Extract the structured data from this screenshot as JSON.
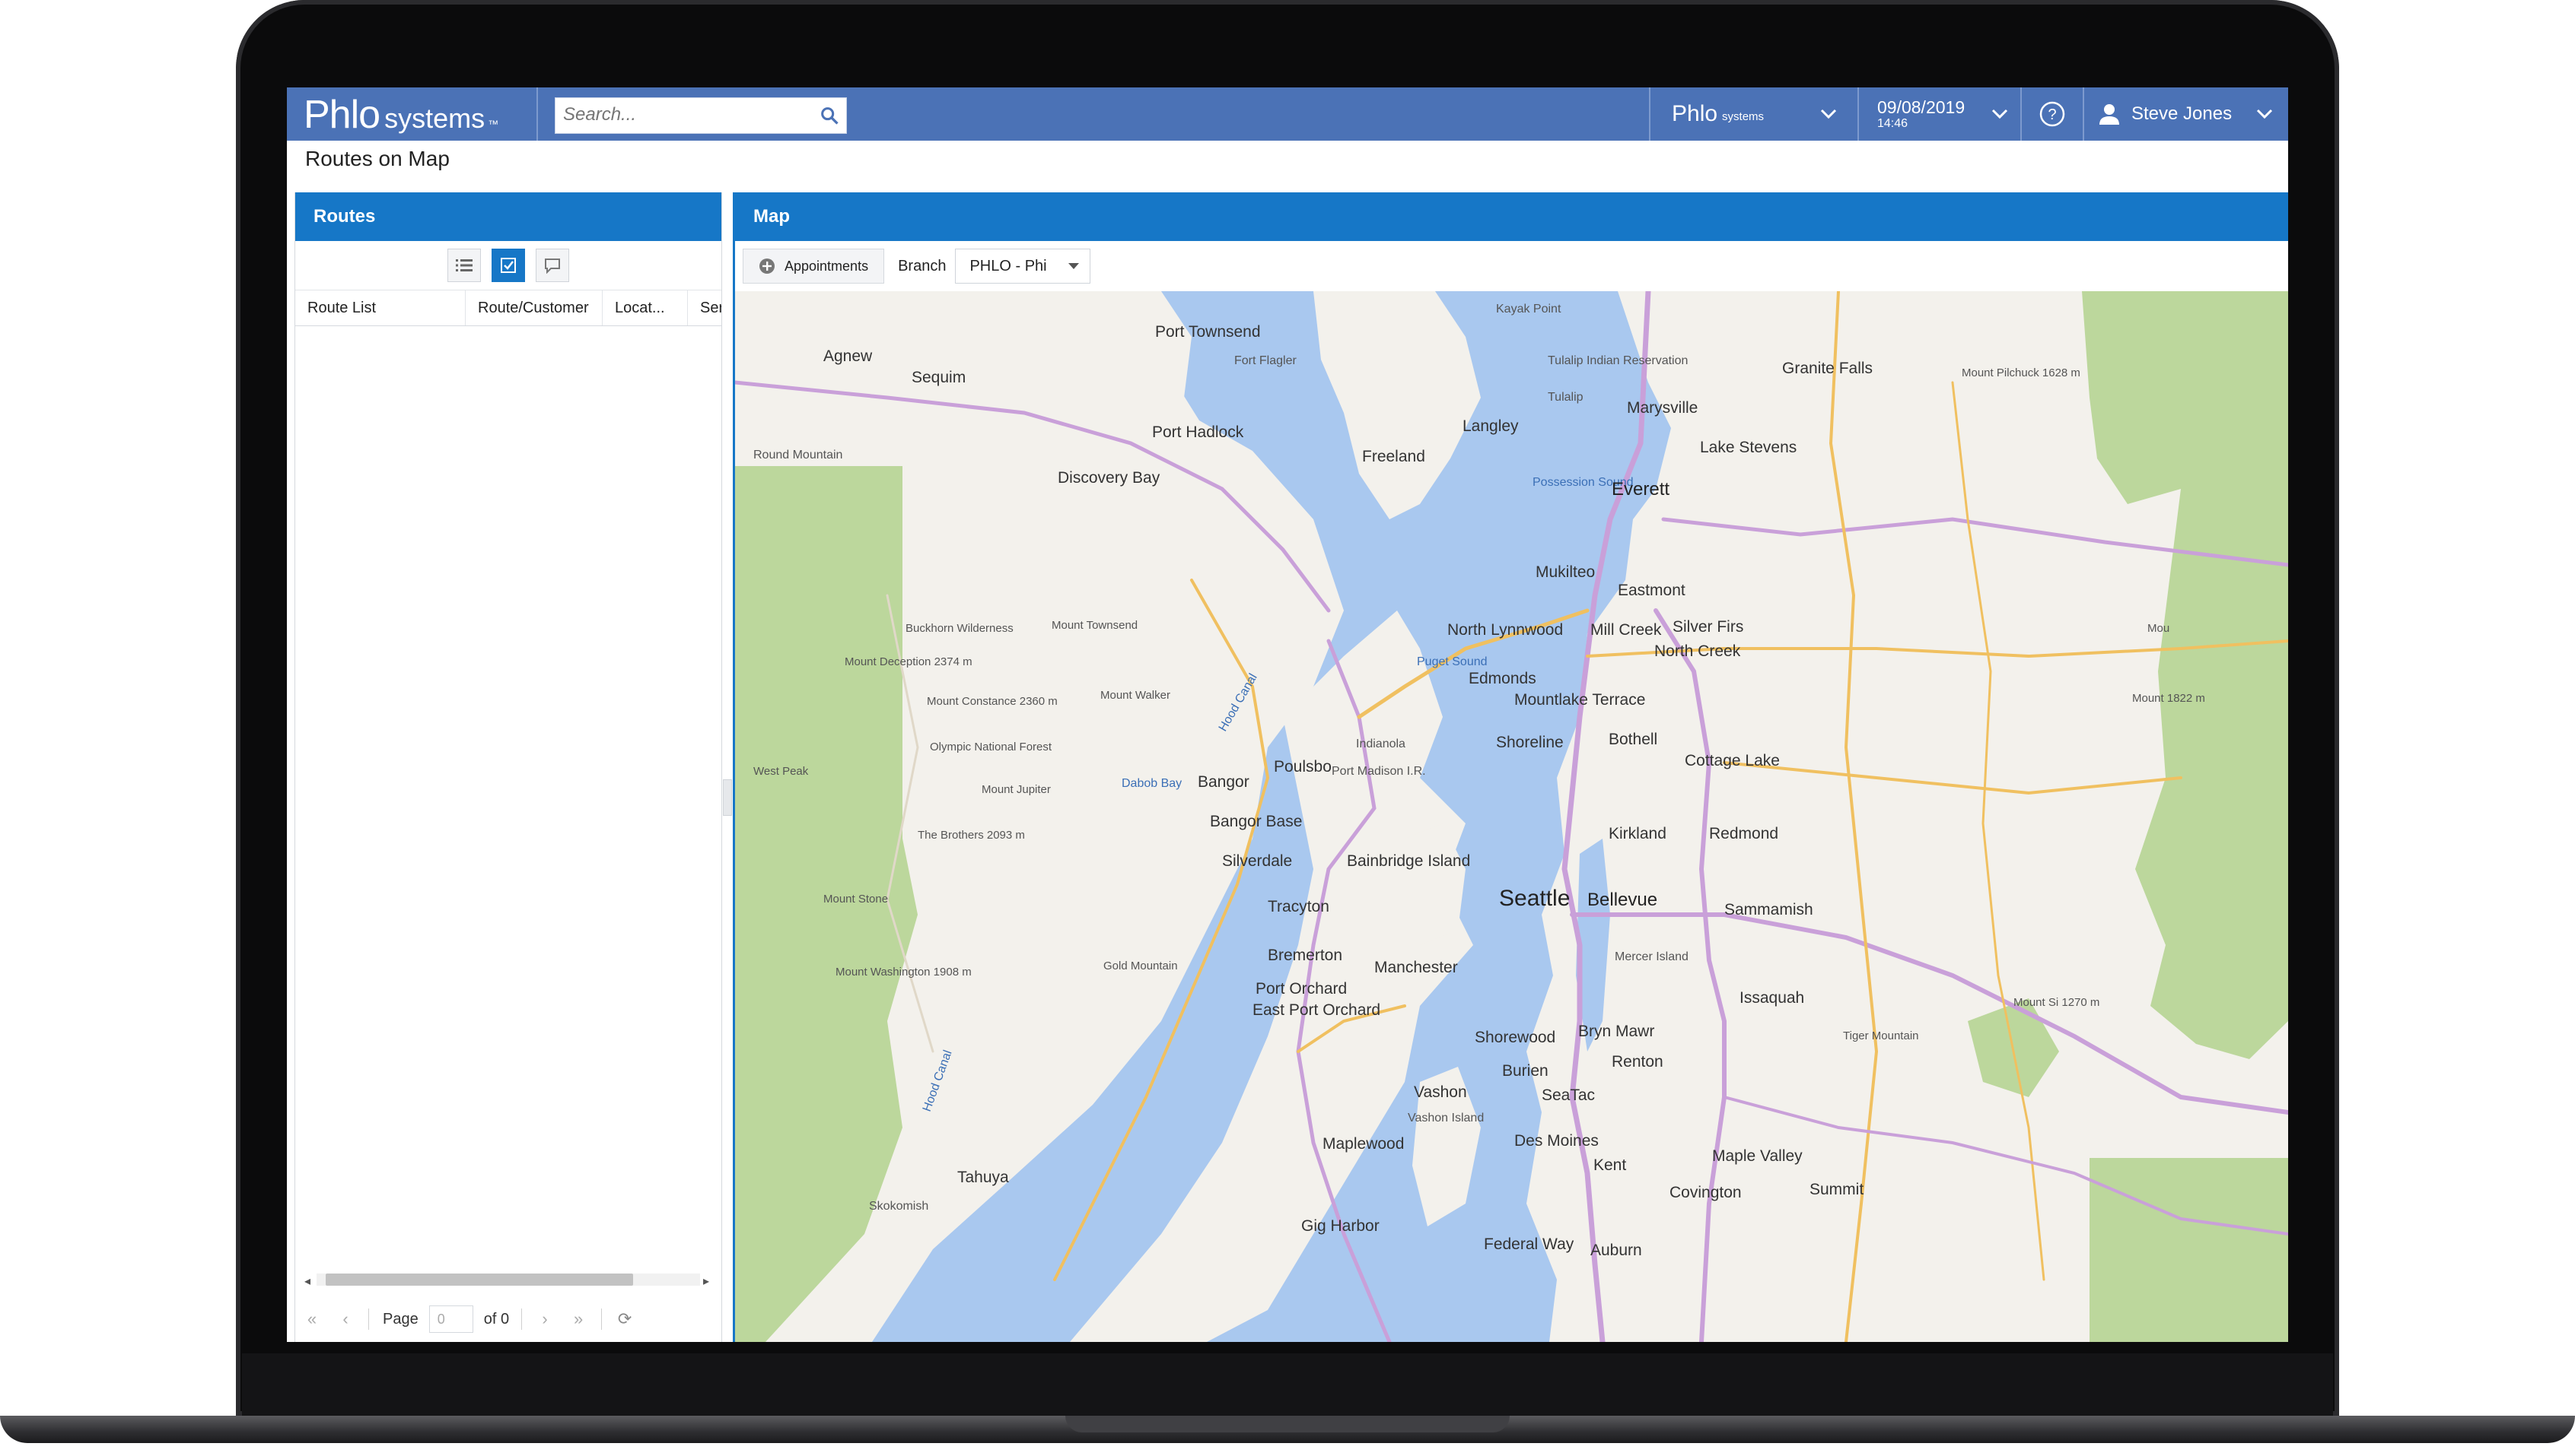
{
  "header": {
    "logo_main": "Phlo",
    "logo_sub": "systems",
    "logo_tm": "™",
    "search_placeholder": "Search...",
    "company_name": "Phlo",
    "company_sub": "systems",
    "date": "09/08/2019",
    "time": "14:46",
    "user_name": "Steve Jones"
  },
  "page_title": "Routes on Map",
  "routes_panel": {
    "title": "Routes",
    "columns": [
      "Route List",
      "Route/Customer",
      "Locat...",
      "Ser"
    ],
    "pager": {
      "page_label": "Page",
      "page_value": "0",
      "of_label": "of 0"
    }
  },
  "map_panel": {
    "title": "Map",
    "appointments_label": "Appointments",
    "branch_label": "Branch",
    "branch_value": "PHLO - Phi"
  },
  "map_labels": {
    "kayak_point": "Kayak Point",
    "agnew": "Agnew",
    "sequim": "Sequim",
    "port_townsend": "Port Townsend",
    "fort_flagler": "Fort Flagler",
    "tulalip_res": "Tulalip Indian Reservation",
    "tulalip": "Tulalip",
    "marysville": "Marysville",
    "granite_falls": "Granite Falls",
    "mount_pilchuck": "Mount Pilchuck 1628 m",
    "port_hadlock": "Port Hadlock",
    "langley": "Langley",
    "lake_stevens": "Lake Stevens",
    "round_mountain": "Round Mountain",
    "freeland": "Freeland",
    "discovery_bay": "Discovery Bay",
    "possession_sound": "Possession Sound",
    "everett": "Everett",
    "mukilteo": "Mukilteo",
    "eastmont": "Eastmont",
    "buckhorn": "Buckhorn Wilderness",
    "mount_townsend": "Mount Townsend",
    "north_lynnwood": "North Lynnwood",
    "mill_creek": "Mill Creek",
    "silver_firs": "Silver Firs",
    "north_creek": "North Creek",
    "mount_deception": "Mount Deception 2374 m",
    "puget_sound": "Puget Sound",
    "hood_canal_n": "Hood Canal",
    "edmonds": "Edmonds",
    "mount_constance": "Mount Constance 2360 m",
    "mount_walker": "Mount Walker",
    "mountlake_terrace": "Mountlake Terrace",
    "olympic_nf": "Olympic National Forest",
    "indianola": "Indianola",
    "shoreline": "Shoreline",
    "bothell": "Bothell",
    "cottage_lake": "Cottage Lake",
    "west_peak": "West Peak",
    "poulsbo": "Poulsbo",
    "port_madison": "Port Madison I.R.",
    "dabob_bay": "Dabob Bay",
    "bangor": "Bangor",
    "mount_jupiter": "Mount Jupiter",
    "bangor_base": "Bangor Base",
    "kirkland": "Kirkland",
    "redmond": "Redmond",
    "the_brothers": "The Brothers 2093 m",
    "silverdale": "Silverdale",
    "bainbridge": "Bainbridge Island",
    "seattle": "Seattle",
    "bellevue": "Bellevue",
    "mount_stone": "Mount Stone",
    "tracyton": "Tracyton",
    "sammamish": "Sammamish",
    "bremerton": "Bremerton",
    "gold_mountain": "Gold Mountain",
    "manchester": "Manchester",
    "mercer_island": "Mercer Island",
    "mount_washington": "Mount Washington 1908 m",
    "port_orchard": "Port Orchard",
    "east_port_orchard": "East Port Orchard",
    "issaquah": "Issaquah",
    "mount_si": "Mount Si 1270 m",
    "shorewood": "Shorewood",
    "bryn_mawr": "Bryn Mawr",
    "tiger_mountain": "Tiger Mountain",
    "renton": "Renton",
    "burien": "Burien",
    "vashon": "Vashon",
    "seatac": "SeaTac",
    "hood_canal_s": "Hood Canal",
    "vashon_island": "Vashon Island",
    "des_moines": "Des Moines",
    "maple_valley": "Maple Valley",
    "kent": "Kent",
    "mapleywood": "Maplewood",
    "tahuya": "Tahuya",
    "summit": "Summit",
    "covington": "Covington",
    "skokomish": "Skokomish",
    "gig_harbor": "Gig Harbor",
    "federal_way": "Federal Way",
    "auburn": "Auburn",
    "mount_edge": "Mou",
    "mount_1822": "Mount 1822 m"
  },
  "colors": {
    "header_bg": "#4b72b6",
    "panel_head": "#1677c7",
    "water": "#a9c8ef",
    "land": "#f3f1ec",
    "forest": "#bcd79c"
  }
}
